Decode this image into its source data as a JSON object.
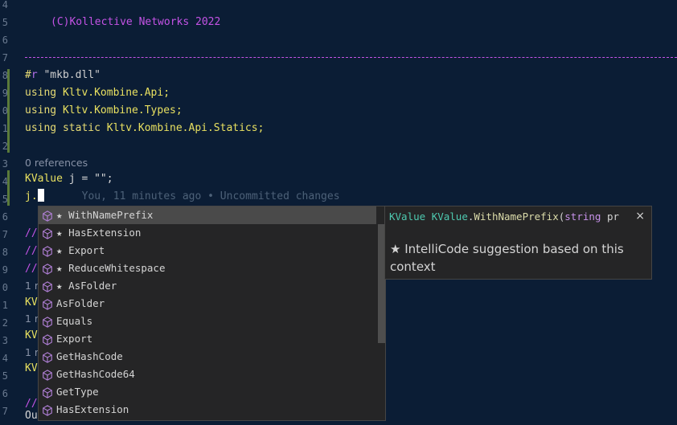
{
  "editor": {
    "line_numbers": [
      "4",
      "5",
      "6",
      "7",
      "8",
      "9",
      "0",
      "1",
      "2",
      "3",
      "4",
      "5",
      "6",
      "7",
      "8",
      "9",
      "0",
      "1",
      "2",
      "3",
      "4",
      "5",
      "6",
      "7"
    ],
    "copyright": "(C)Kollective Networks 2022",
    "directive_hash": "#",
    "directive_kw": "r",
    "directive_str": "\"mkb.dll\"",
    "using_kw": "using",
    "using_static_kw": "using static",
    "ns1": "Kltv.Kombine.Api;",
    "ns2": "Kltv.Kombine.Types;",
    "ns3": "Kltv.Kombine.Api.Statics;",
    "references": "0 references",
    "decl_type": "KValue",
    "decl_rest": " j = \"\";",
    "current_line": "j.",
    "blame": "You, 11 minutes ago • Uncommitted changes",
    "left_fragments": [
      "//",
      "//",
      "//",
      "1 r",
      "KV",
      "1 r",
      "KV",
      "1 r",
      "KV",
      "//"
    ],
    "bottom_line": "OutputBin.Export(\"outputbin\");"
  },
  "suggestions": [
    {
      "label": "WithNamePrefix",
      "starred": true,
      "selected": true,
      "icon": "method-cube-icon"
    },
    {
      "label": "HasExtension",
      "starred": true,
      "selected": false,
      "icon": "method-cube-icon"
    },
    {
      "label": "Export",
      "starred": true,
      "selected": false,
      "icon": "method-cube-icon"
    },
    {
      "label": "ReduceWhitespace",
      "starred": true,
      "selected": false,
      "icon": "method-cube-icon"
    },
    {
      "label": "AsFolder",
      "starred": true,
      "selected": false,
      "icon": "method-cube-icon"
    },
    {
      "label": "AsFolder",
      "starred": false,
      "selected": false,
      "icon": "method-cube-icon"
    },
    {
      "label": "Equals",
      "starred": false,
      "selected": false,
      "icon": "method-cube-icon"
    },
    {
      "label": "Export",
      "starred": false,
      "selected": false,
      "icon": "method-cube-icon"
    },
    {
      "label": "GetHashCode",
      "starred": false,
      "selected": false,
      "icon": "method-cube-icon"
    },
    {
      "label": "GetHashCode64",
      "starred": false,
      "selected": false,
      "icon": "method-cube-icon"
    },
    {
      "label": "GetType",
      "starred": false,
      "selected": false,
      "icon": "method-cube-icon"
    },
    {
      "label": "HasExtension",
      "starred": false,
      "selected": false,
      "icon": "method-cube-icon"
    }
  ],
  "details": {
    "sig_type1": "KValue",
    "sig_type2": "KValue",
    "sig_dot": ".",
    "sig_method": "WithNamePrefix",
    "sig_paren": "(",
    "sig_kw": "string",
    "sig_param": " pr",
    "close": "×",
    "description": "★ IntelliCode suggestion based on this context"
  },
  "colors": {
    "background": "#0b1d35",
    "comment": "#c553e6",
    "keyword": "#e6db74",
    "suggest_bg": "#252526",
    "suggest_selected": "#4a4a4a",
    "icon": "#b180d7"
  }
}
